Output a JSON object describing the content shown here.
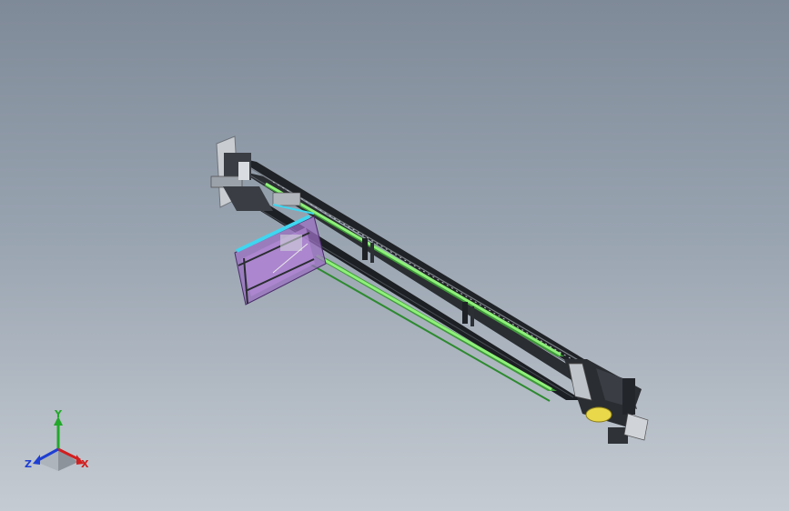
{
  "viewport": {
    "background_top": "#7f8a98",
    "background_bottom": "#c5cbd2"
  },
  "model": {
    "description_icon": "cad-assembly-icon",
    "colors": {
      "frame": "#2a2d31",
      "rail_highlight": "#8ff07a",
      "rail_shadow": "#3f9a3a",
      "gripper_frame": "#a77cc7",
      "gripper_accent": "#3fd6f0",
      "motor_base": "#e9d84a"
    }
  },
  "triad": {
    "labels": {
      "x": "X",
      "y": "Y",
      "z": "Z"
    },
    "colors": {
      "x": "#d21f1f",
      "y": "#22a82a",
      "z": "#1f3fd2"
    }
  }
}
